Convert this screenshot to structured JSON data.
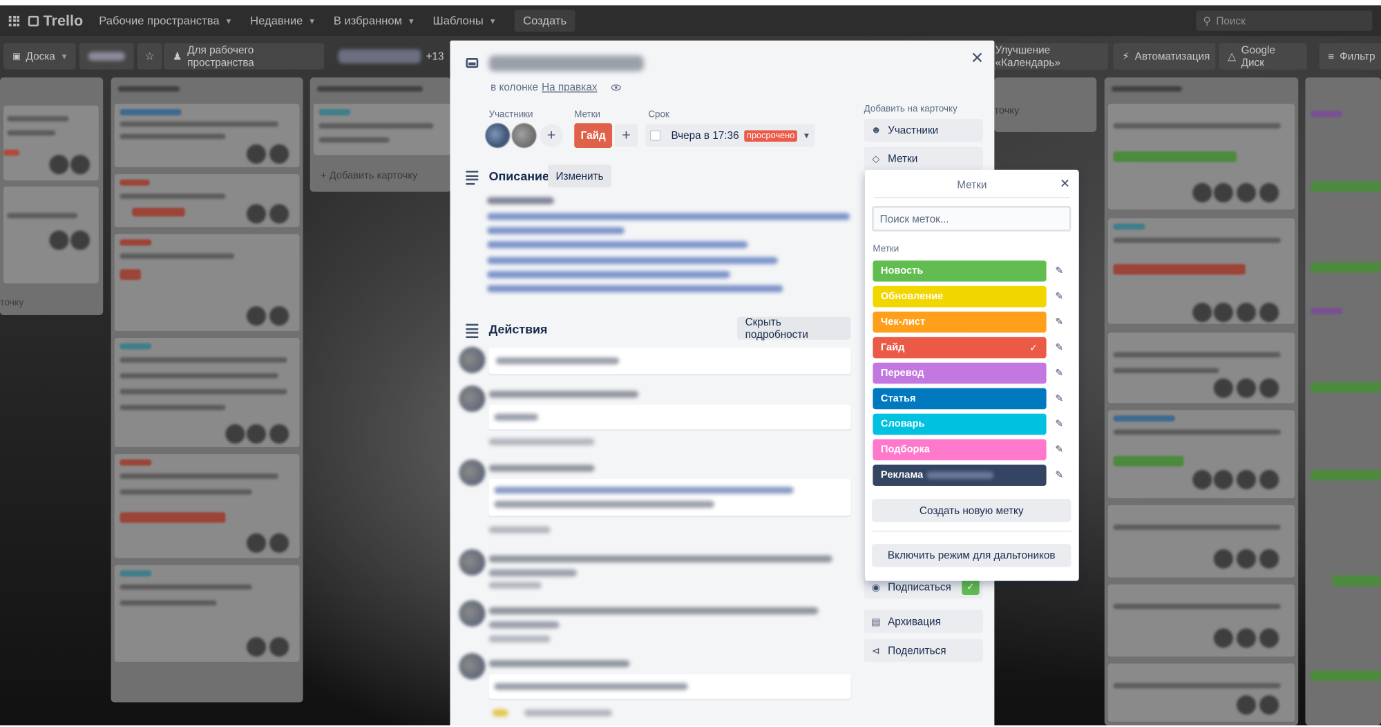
{
  "topbar": {
    "logo": "Trello",
    "nav": [
      "Рабочие пространства",
      "Недавние",
      "В избранном",
      "Шаблоны"
    ],
    "create": "Создать",
    "search_placeholder": "Поиск"
  },
  "boardbar": {
    "view": "Доска",
    "workspace_visibility": "Для рабочего пространства",
    "members_count": "+13",
    "calendar_powerup": "Улучшение «Календарь»",
    "automation": "Автоматизация",
    "google_drive": "Google Диск",
    "filter": "Фильтр"
  },
  "background_lists": {
    "add_card": "Добавить карточку",
    "add_card_clipped_left": "точку",
    "add_card_clipped_right": "точку"
  },
  "card": {
    "in_list_prefix": "в колонке",
    "list_name": "На правках",
    "members_label": "Участники",
    "labels_label": "Метки",
    "label_applied": "Гайд",
    "due_label": "Срок",
    "due_value": "Вчера в 17:36",
    "overdue_badge": "просрочено",
    "description_title": "Описание",
    "edit_button": "Изменить",
    "activity_title": "Действия",
    "hide_details_button": "Скрыть подробности"
  },
  "sidebar": {
    "add_to_card": "Добавить на карточку",
    "members": "Участники",
    "labels": "Метки",
    "subscribe": "Подписаться",
    "archive": "Архивация",
    "share": "Поделиться"
  },
  "labels_popover": {
    "title": "Метки",
    "search_placeholder": "Поиск меток...",
    "subtitle": "Метки",
    "labels": [
      {
        "name": "Новость",
        "color": "#61bd4f",
        "checked": false
      },
      {
        "name": "Обновление",
        "color": "#f2d600",
        "checked": false
      },
      {
        "name": "Чек-лист",
        "color": "#ff9f1a",
        "checked": false
      },
      {
        "name": "Гайд",
        "color": "#eb5a46",
        "checked": true
      },
      {
        "name": "Перевод",
        "color": "#c377e0",
        "checked": false
      },
      {
        "name": "Статья",
        "color": "#0079bf",
        "checked": false
      },
      {
        "name": "Словарь",
        "color": "#00c2e0",
        "checked": false
      },
      {
        "name": "Подборка",
        "color": "#ff78cb",
        "checked": false
      },
      {
        "name": "Реклама",
        "color": "#344563",
        "checked": false
      }
    ],
    "create_label_button": "Создать новую метку",
    "colorblind_button": "Включить режим для дальтоников"
  }
}
